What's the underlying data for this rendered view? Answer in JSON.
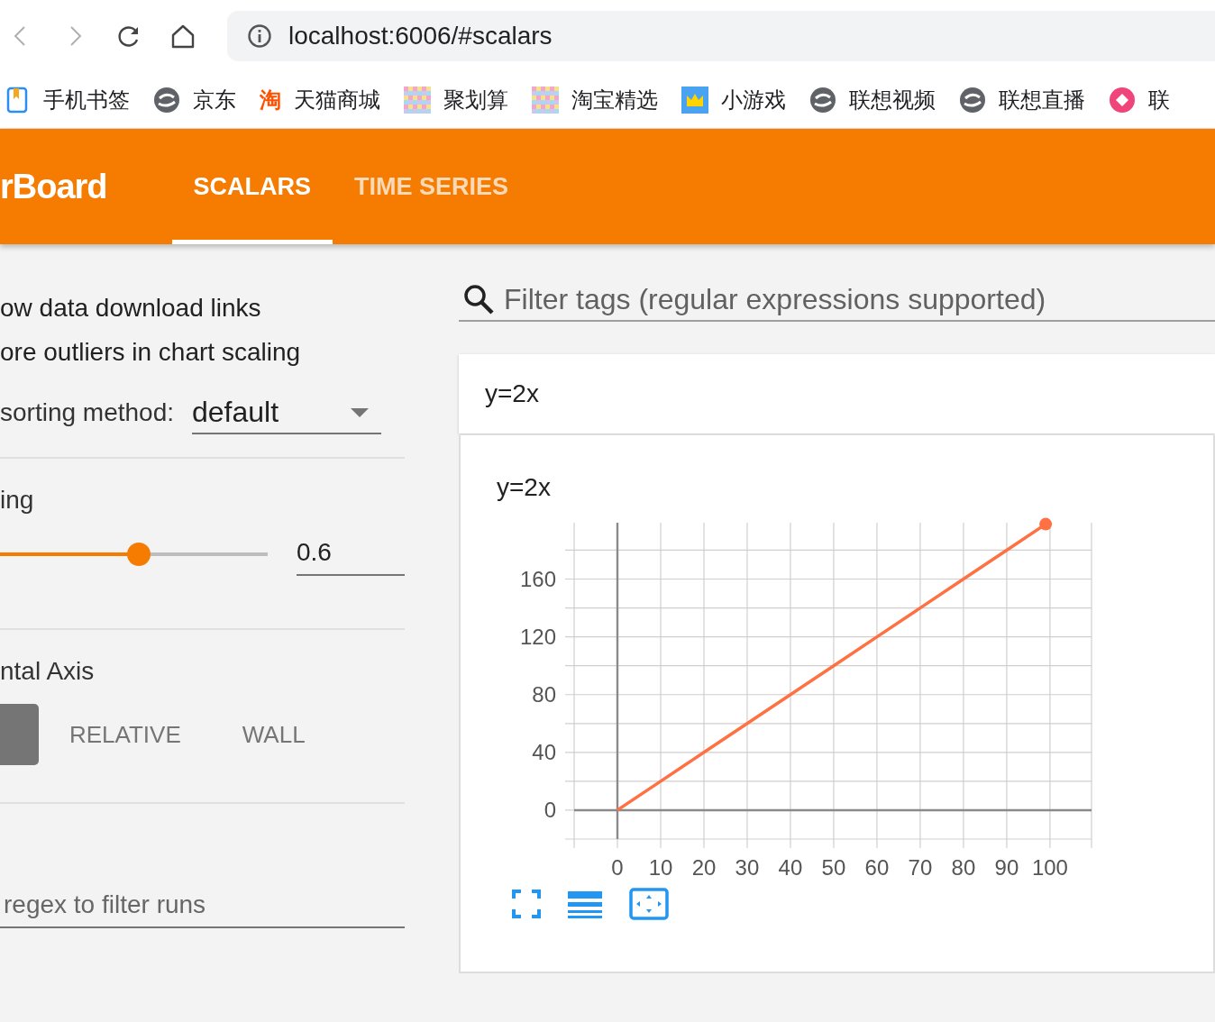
{
  "browser": {
    "address": "localhost:6006/#scalars",
    "bookmarks": [
      {
        "label": "手机书签",
        "kind": "bookmark"
      },
      {
        "label": "京东",
        "kind": "swirl"
      },
      {
        "label": "天猫商城",
        "kind": "glyph",
        "glyph": "淘"
      },
      {
        "label": "聚划算",
        "kind": "mosaic"
      },
      {
        "label": "淘宝精选",
        "kind": "mosaic"
      },
      {
        "label": "小游戏",
        "kind": "crown"
      },
      {
        "label": "联想视频",
        "kind": "swirl"
      },
      {
        "label": "联想直播",
        "kind": "swirl"
      },
      {
        "label": "联",
        "kind": "ring"
      }
    ]
  },
  "header": {
    "title": "rBoard",
    "tabs": [
      {
        "label": "SCALARS",
        "selected": true
      },
      {
        "label": "TIME SERIES",
        "selected": false
      }
    ]
  },
  "sidebar": {
    "options": [
      {
        "label": "ow data download links"
      },
      {
        "label": "ore outliers in chart scaling"
      }
    ],
    "sorting": {
      "label": "sorting method:",
      "value": "default"
    },
    "smoothing": {
      "label": "ing",
      "level": 0.52,
      "value": "0.6"
    },
    "axis": {
      "label": "ntal Axis",
      "buttons": [
        {
          "selected": true
        },
        {
          "label": "RELATIVE",
          "selected": false
        },
        {
          "label": "WALL",
          "selected": false
        }
      ]
    },
    "runs_filter": {
      "placeholder": "regex to filter runs"
    }
  },
  "filter": {
    "placeholder": "Filter tags (regular expressions supported)"
  },
  "card": {
    "title": "y=2x",
    "chart_data": {
      "type": "line",
      "title": "y=2x",
      "x": [
        0,
        10,
        20,
        30,
        40,
        50,
        60,
        70,
        80,
        90,
        99
      ],
      "grid": true,
      "series": [
        {
          "color": "#ff7043",
          "values": [
            0,
            20,
            40,
            60,
            80,
            100,
            120,
            140,
            160,
            180,
            198
          ]
        }
      ],
      "xlim": [
        -10,
        109.6
      ],
      "ylim": [
        -20,
        199
      ],
      "xticks": [
        0,
        10,
        20,
        30,
        40,
        50,
        60,
        70,
        80,
        90,
        100
      ],
      "yticks": [
        0,
        40,
        80,
        120,
        160
      ]
    }
  }
}
